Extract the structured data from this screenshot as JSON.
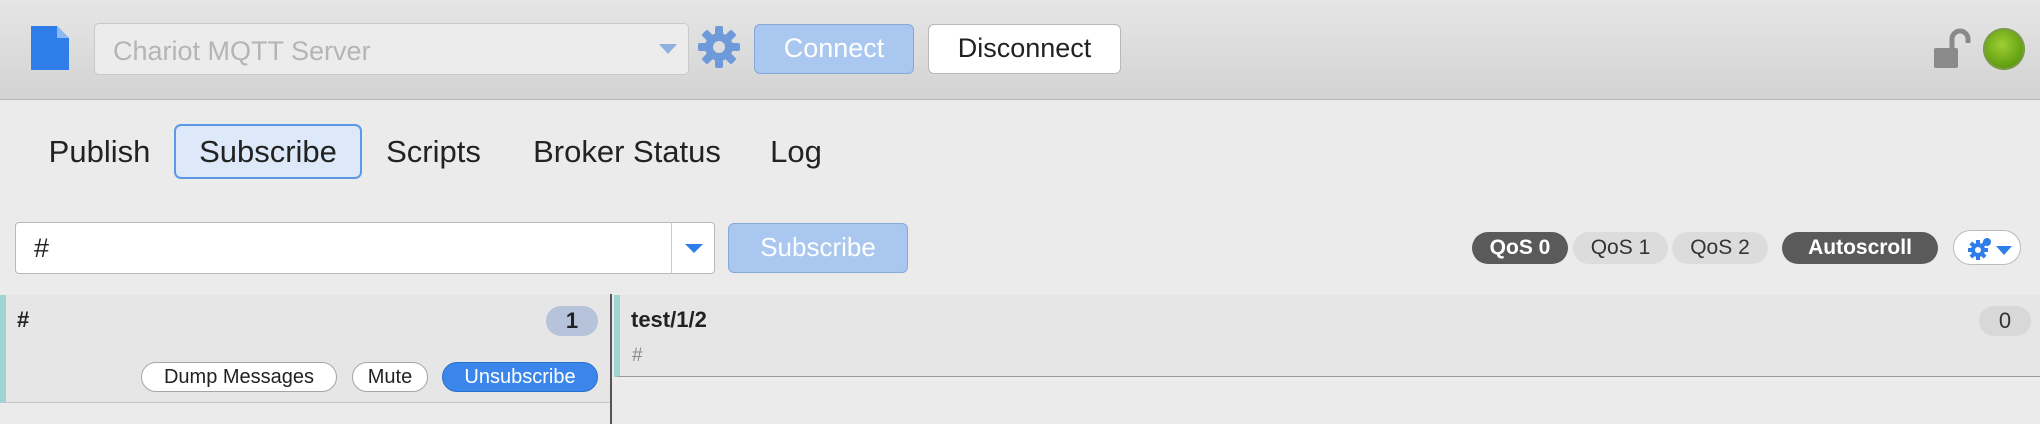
{
  "toolbar": {
    "server_placeholder": "Chariot MQTT Server",
    "connect_label": "Connect",
    "disconnect_label": "Disconnect"
  },
  "tabs": [
    {
      "label": "Publish"
    },
    {
      "label": "Subscribe",
      "selected": true
    },
    {
      "label": "Scripts"
    },
    {
      "label": "Broker Status"
    },
    {
      "label": "Log"
    }
  ],
  "subscribe": {
    "topic_value": "#",
    "subscribe_label": "Subscribe",
    "qos_options": [
      "QoS 0",
      "QoS 1",
      "QoS 2"
    ],
    "selected_qos": "QoS 0",
    "autoscroll_label": "Autoscroll"
  },
  "subscriptions": [
    {
      "topic": "#",
      "count": "1",
      "dump_label": "Dump Messages",
      "mute_label": "Mute",
      "unsubscribe_label": "Unsubscribe"
    }
  ],
  "messages": [
    {
      "topic": "test/1/2",
      "payload": "#",
      "count": "0"
    }
  ],
  "icons": {
    "document": "document-icon",
    "gear": "gear-icon",
    "lock": "unlocked-icon",
    "status": "connection-status-icon"
  },
  "colors": {
    "accent": "#3a86ea",
    "disabled_button": "#a9c7ef",
    "status_green": "#6aaa14",
    "row_marker": "#9fd5d1"
  }
}
